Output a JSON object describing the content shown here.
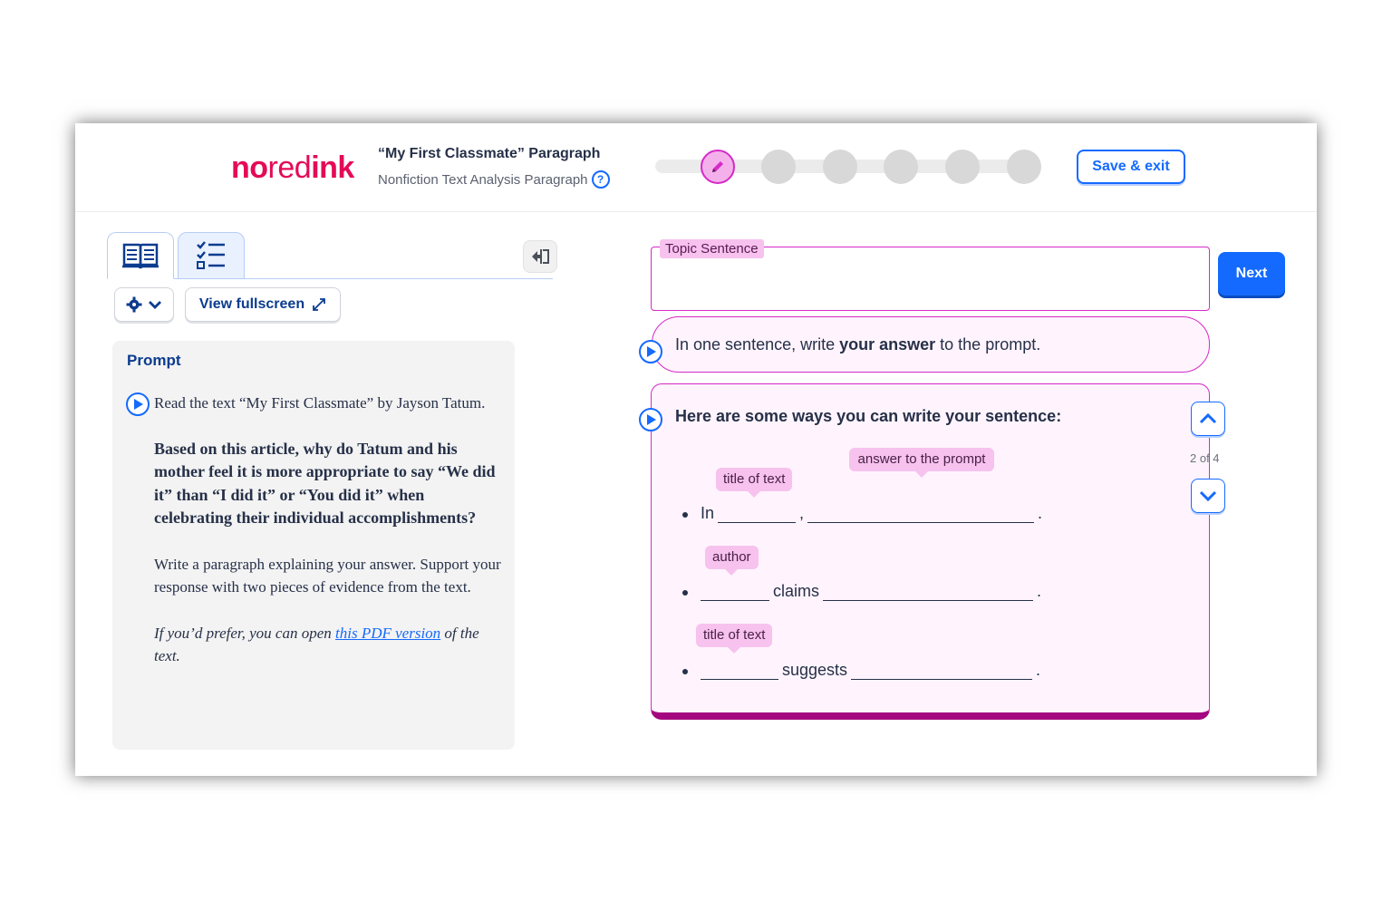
{
  "header": {
    "logo": {
      "no": "no",
      "red": "red",
      "ink": "ink"
    },
    "assignment_title": "“My First Classmate” Paragraph",
    "assignment_subtitle": "Nonfiction Text Analysis Paragraph",
    "help_icon": "question-icon",
    "save_exit_label": "Save & exit",
    "progress": {
      "total_steps": 6,
      "current_step": 1
    }
  },
  "left_panel": {
    "tabs": [
      {
        "icon": "book-icon"
      },
      {
        "icon": "checklist-icon"
      }
    ],
    "view_fullscreen_label": "View fullscreen",
    "prompt": {
      "label": "Prompt",
      "intro": "Read the text “My First Classmate” by Jayson Tatum.",
      "question": "Based on this article, why do Tatum and his mother feel it is more appropriate to say “We did it” than “I did it” or “You did it” when celebrating their individual accomplishments?",
      "instructions": "Write a paragraph explaining your answer. Support your response with two pieces of evidence from the text.",
      "pdf_pre": "If you’d prefer, you can open ",
      "pdf_link": "this PDF version",
      "pdf_post": " of the text."
    }
  },
  "right_panel": {
    "topic_label": "Topic Sentence",
    "topic_value": "",
    "next_label": "Next",
    "instruction_pre": "In one sentence, write ",
    "instruction_bold": "your answer",
    "instruction_post": " to the prompt.",
    "ways_title": "Here are some ways you can write your sentence:",
    "page_count": "2 of 4",
    "frames": {
      "f1": {
        "tag1": "title of text",
        "tag2": "answer to the prompt",
        "word": "In",
        "sep": ",",
        "end": "."
      },
      "f2": {
        "tag1": "author",
        "word": "claims",
        "end": "."
      },
      "f3": {
        "tag1": "title of text",
        "word": "suggests",
        "end": "."
      }
    }
  },
  "colors": {
    "accent_blue": "#146aff",
    "brand_pink": "#e50a57",
    "highlight_magenta": "#d52ac7"
  }
}
